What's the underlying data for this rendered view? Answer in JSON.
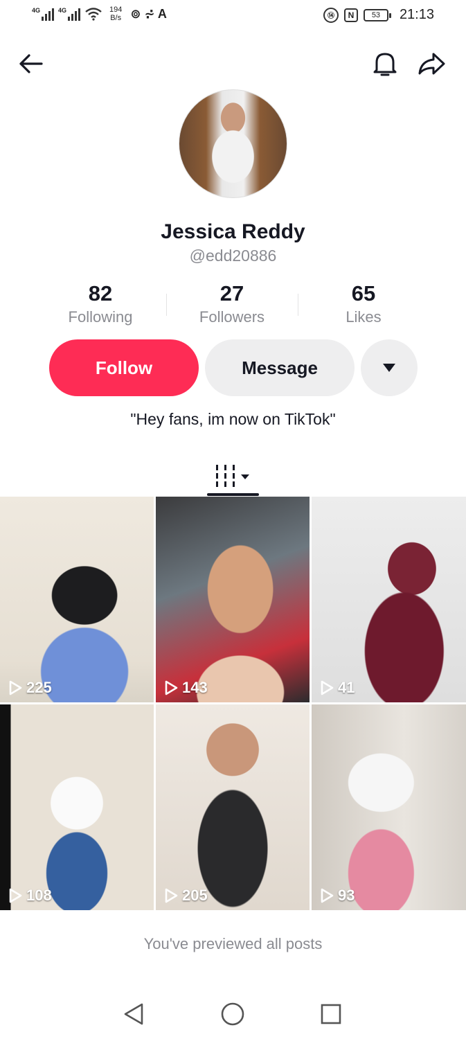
{
  "status_bar": {
    "signal1_tag": "4G",
    "signal2_tag": "4G",
    "net_speed_value": "194",
    "net_speed_unit": "B/s",
    "extra_icons": "⊚ ⩫ A",
    "volte": "⑭",
    "nfc": "N",
    "battery": "53",
    "time": "21:13"
  },
  "header": {
    "back_icon": "arrow-left",
    "bell_icon": "bell-outline",
    "share_icon": "share-arrow"
  },
  "profile": {
    "display_name": "Jessica Reddy",
    "username": "@edd20886",
    "bio": "\"Hey fans, im now on TikTok\""
  },
  "stats": [
    {
      "value": "82",
      "label": "Following"
    },
    {
      "value": "27",
      "label": "Followers"
    },
    {
      "value": "65",
      "label": "Likes"
    }
  ],
  "actions": {
    "follow_label": "Follow",
    "message_label": "Message",
    "more_icon": "caret-down"
  },
  "colors": {
    "accent": "#fe2c55",
    "text_primary": "#161823",
    "text_secondary": "#8a8b91",
    "button_secondary": "#eeeeef"
  },
  "tabs": {
    "grid_icon": "videos-grid-with-caret"
  },
  "posts": [
    {
      "views": "225"
    },
    {
      "views": "143"
    },
    {
      "views": "41"
    },
    {
      "views": "108"
    },
    {
      "views": "205"
    },
    {
      "views": "93"
    }
  ],
  "end_note": "You've previewed all posts",
  "system_nav": {
    "back_icon": "triangle-back",
    "home_icon": "circle-home",
    "recents_icon": "square-recents"
  }
}
